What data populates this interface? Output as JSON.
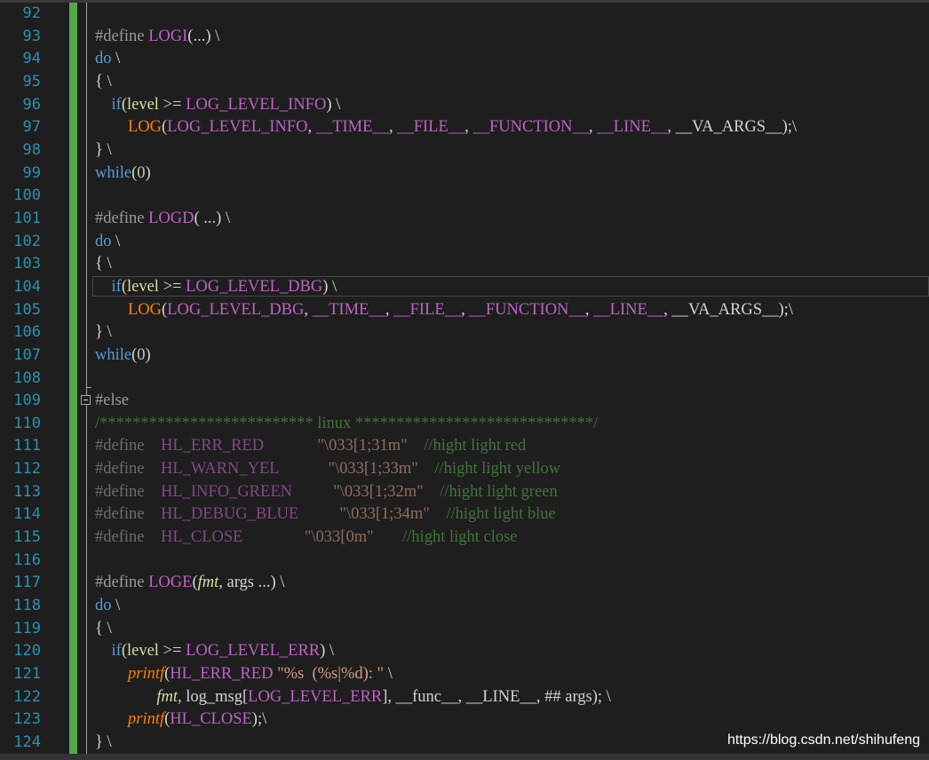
{
  "editor": {
    "line_numbers": [
      "92",
      "93",
      "94",
      "95",
      "96",
      "97",
      "98",
      "99",
      "100",
      "101",
      "102",
      "103",
      "104",
      "105",
      "106",
      "107",
      "108",
      "109",
      "110",
      "111",
      "112",
      "113",
      "114",
      "115",
      "116",
      "117",
      "118",
      "119",
      "120",
      "121",
      "122",
      "123",
      "124"
    ],
    "lines": [
      [],
      [
        {
          "t": "#define ",
          "c": "pp"
        },
        {
          "t": "LOGI",
          "c": "mac"
        },
        {
          "t": "(...) \\",
          "c": "ppr"
        }
      ],
      [
        {
          "t": "do",
          "c": "kw"
        },
        {
          "t": " \\",
          "c": "ppr"
        }
      ],
      [
        {
          "t": "{ \\",
          "c": "ppr"
        }
      ],
      [
        {
          "t": "    ",
          "c": ""
        },
        {
          "t": "if",
          "c": "kw"
        },
        {
          "t": "(level ",
          "c": "fnm"
        },
        {
          "t": ">= ",
          "c": "ppr"
        },
        {
          "t": "LOG_LEVEL_INFO",
          "c": "mac"
        },
        {
          "t": ") \\",
          "c": "ppr"
        }
      ],
      [
        {
          "t": "        ",
          "c": ""
        },
        {
          "t": "LOG",
          "c": "lg"
        },
        {
          "t": "(",
          "c": "ppr"
        },
        {
          "t": "LOG_LEVEL_INFO",
          "c": "mac"
        },
        {
          "t": ", ",
          "c": "ppr"
        },
        {
          "t": "__TIME__",
          "c": "mac"
        },
        {
          "t": ", ",
          "c": "ppr"
        },
        {
          "t": "__FILE__",
          "c": "mac"
        },
        {
          "t": ", ",
          "c": "ppr"
        },
        {
          "t": "__FUNCTION__",
          "c": "mac"
        },
        {
          "t": ", ",
          "c": "ppr"
        },
        {
          "t": "__LINE__",
          "c": "mac"
        },
        {
          "t": ", ",
          "c": "ppr"
        },
        {
          "t": "__VA_ARGS__",
          "c": "ppr"
        },
        {
          "t": ");\\",
          "c": "ppr"
        }
      ],
      [
        {
          "t": "} \\",
          "c": "ppr"
        }
      ],
      [
        {
          "t": "while",
          "c": "kw"
        },
        {
          "t": "(",
          "c": "ppr"
        },
        {
          "t": "0",
          "c": "num"
        },
        {
          "t": ")",
          "c": "ppr"
        }
      ],
      [],
      [
        {
          "t": "#define ",
          "c": "pp"
        },
        {
          "t": "LOGD",
          "c": "mac"
        },
        {
          "t": "( ...) \\",
          "c": "ppr"
        }
      ],
      [
        {
          "t": "do",
          "c": "kw"
        },
        {
          "t": " \\",
          "c": "ppr"
        }
      ],
      [
        {
          "t": "{ \\",
          "c": "ppr"
        }
      ],
      [
        {
          "t": "    ",
          "c": ""
        },
        {
          "t": "if",
          "c": "kw"
        },
        {
          "t": "(level ",
          "c": "fnm"
        },
        {
          "t": ">= ",
          "c": "ppr"
        },
        {
          "t": "LOG_LEVEL_DBG",
          "c": "mac"
        },
        {
          "t": ") \\",
          "c": "ppr"
        }
      ],
      [
        {
          "t": "        ",
          "c": ""
        },
        {
          "t": "LOG",
          "c": "lg"
        },
        {
          "t": "(",
          "c": "ppr"
        },
        {
          "t": "LOG_LEVEL_DBG",
          "c": "mac"
        },
        {
          "t": ", ",
          "c": "ppr"
        },
        {
          "t": "__TIME__",
          "c": "mac"
        },
        {
          "t": ", ",
          "c": "ppr"
        },
        {
          "t": "__FILE__",
          "c": "mac"
        },
        {
          "t": ", ",
          "c": "ppr"
        },
        {
          "t": "__FUNCTION__",
          "c": "mac"
        },
        {
          "t": ", ",
          "c": "ppr"
        },
        {
          "t": "__LINE__",
          "c": "mac"
        },
        {
          "t": ", ",
          "c": "ppr"
        },
        {
          "t": "__VA_ARGS__",
          "c": "ppr"
        },
        {
          "t": ");\\",
          "c": "ppr"
        }
      ],
      [
        {
          "t": "} \\",
          "c": "ppr"
        }
      ],
      [
        {
          "t": "while",
          "c": "kw"
        },
        {
          "t": "(",
          "c": "ppr"
        },
        {
          "t": "0",
          "c": "num"
        },
        {
          "t": ")",
          "c": "ppr"
        }
      ],
      [],
      [
        {
          "t": "#else",
          "c": "pp"
        }
      ],
      [
        {
          "t": "/************************** linux *****************************/",
          "c": "cmt"
        }
      ],
      [
        {
          "t": "#define    ",
          "c": "pp"
        },
        {
          "t": "HL_ERR_RED             ",
          "c": "mac"
        },
        {
          "t": "\"\\033[1;31m\"    ",
          "c": "str"
        },
        {
          "t": "//hight light red",
          "c": "cmt"
        }
      ],
      [
        {
          "t": "#define    ",
          "c": "pp"
        },
        {
          "t": "HL_WARN_YEL            ",
          "c": "mac"
        },
        {
          "t": "\"\\033[1;33m\"    ",
          "c": "str"
        },
        {
          "t": "//hight light yellow",
          "c": "cmt"
        }
      ],
      [
        {
          "t": "#define    ",
          "c": "pp"
        },
        {
          "t": "HL_INFO_GREEN          ",
          "c": "mac"
        },
        {
          "t": "\"\\033[1;32m\"    ",
          "c": "str"
        },
        {
          "t": "//hight light green",
          "c": "cmt"
        }
      ],
      [
        {
          "t": "#define    ",
          "c": "pp"
        },
        {
          "t": "HL_DEBUG_BLUE          ",
          "c": "mac"
        },
        {
          "t": "\"\\033[1;34m\"    ",
          "c": "str"
        },
        {
          "t": "//hight light blue",
          "c": "cmt"
        }
      ],
      [
        {
          "t": "#define    ",
          "c": "pp"
        },
        {
          "t": "HL_CLOSE               ",
          "c": "mac"
        },
        {
          "t": "\"\\033[0m\"       ",
          "c": "str"
        },
        {
          "t": "//hight light close",
          "c": "cmt"
        }
      ],
      [],
      [
        {
          "t": "#define ",
          "c": "pp"
        },
        {
          "t": "LOGE",
          "c": "mac"
        },
        {
          "t": "(",
          "c": "ppr"
        },
        {
          "t": "fmt",
          "c": "fnm it"
        },
        {
          "t": ", args ...) \\",
          "c": "ppr"
        }
      ],
      [
        {
          "t": "do",
          "c": "kw"
        },
        {
          "t": " \\",
          "c": "ppr"
        }
      ],
      [
        {
          "t": "{ \\",
          "c": "ppr"
        }
      ],
      [
        {
          "t": "    ",
          "c": ""
        },
        {
          "t": "if",
          "c": "kw"
        },
        {
          "t": "(level ",
          "c": "fnm"
        },
        {
          "t": ">= ",
          "c": "ppr"
        },
        {
          "t": "LOG_LEVEL_ERR",
          "c": "mac"
        },
        {
          "t": ") \\",
          "c": "ppr"
        }
      ],
      [
        {
          "t": "        ",
          "c": ""
        },
        {
          "t": "printf",
          "c": "lg it"
        },
        {
          "t": "(",
          "c": "ppr"
        },
        {
          "t": "HL_ERR_RED ",
          "c": "mac"
        },
        {
          "t": "\"%s  (%s|%d): \"",
          "c": "str"
        },
        {
          "t": " \\",
          "c": "ppr"
        }
      ],
      [
        {
          "t": "               ",
          "c": ""
        },
        {
          "t": "fmt",
          "c": "fnm it"
        },
        {
          "t": ", log_msg[",
          "c": "ppr"
        },
        {
          "t": "LOG_LEVEL_ERR",
          "c": "mac"
        },
        {
          "t": "], __func__, __LINE__, ## args); \\",
          "c": "ppr"
        }
      ],
      [
        {
          "t": "        ",
          "c": ""
        },
        {
          "t": "printf",
          "c": "lg it"
        },
        {
          "t": "(",
          "c": "ppr"
        },
        {
          "t": "HL_CLOSE",
          "c": "mac"
        },
        {
          "t": ");\\",
          "c": "ppr"
        }
      ],
      [
        {
          "t": "} \\",
          "c": "ppr"
        }
      ]
    ]
  },
  "watermark": "https://blog.csdn.net/shihufeng"
}
